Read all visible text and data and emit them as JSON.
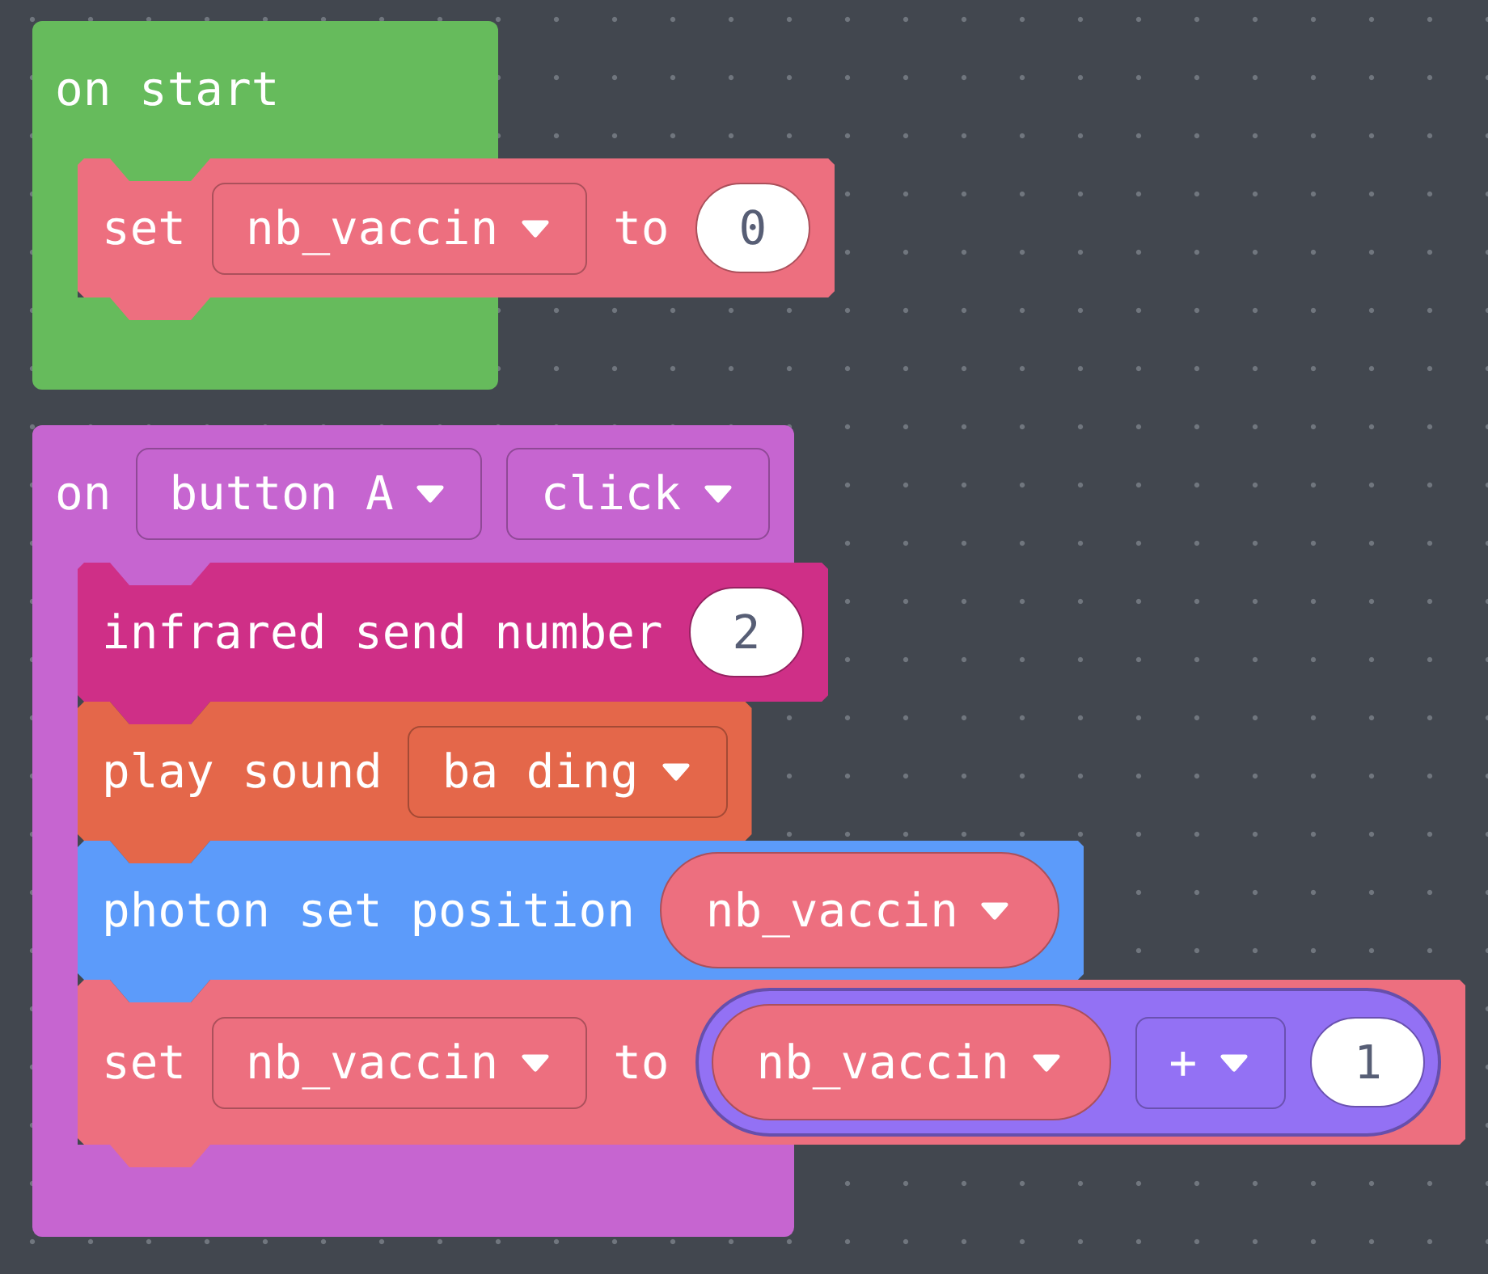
{
  "workspace": {
    "blocks": [
      {
        "color": "#66bb5c",
        "header": [
          {
            "kind": "label",
            "text": "on start"
          }
        ],
        "body": [
          {
            "color": "#ed6f7f",
            "parts": [
              {
                "kind": "label",
                "text": "set"
              },
              {
                "kind": "dropdown",
                "text": "nb_vaccin"
              },
              {
                "kind": "label",
                "text": "to"
              },
              {
                "kind": "number",
                "text": "0"
              }
            ]
          }
        ]
      },
      {
        "color": "#c665d0",
        "header": [
          {
            "kind": "label",
            "text": "on"
          },
          {
            "kind": "dropdown",
            "text": "button A"
          },
          {
            "kind": "dropdown",
            "text": "click"
          }
        ],
        "body": [
          {
            "color": "#cf2f87",
            "parts": [
              {
                "kind": "label",
                "text": "infrared send number"
              },
              {
                "kind": "number",
                "text": "2"
              }
            ]
          },
          {
            "color": "#e4674a",
            "parts": [
              {
                "kind": "label",
                "text": "play sound"
              },
              {
                "kind": "dropdown",
                "text": "ba ding"
              }
            ]
          },
          {
            "color": "#5c9bfa",
            "parts": [
              {
                "kind": "label",
                "text": "photon set position"
              },
              {
                "kind": "reporter",
                "color": "#ed6f7f",
                "text": "nb_vaccin"
              }
            ]
          },
          {
            "color": "#ed6f7f",
            "parts": [
              {
                "kind": "label",
                "text": "set"
              },
              {
                "kind": "dropdown",
                "text": "nb_vaccin"
              },
              {
                "kind": "label",
                "text": "to"
              },
              {
                "kind": "operation",
                "color": "#9371f4",
                "parts": [
                  {
                    "kind": "reporter",
                    "color": "#ed6f7f",
                    "text": "nb_vaccin"
                  },
                  {
                    "kind": "dropdown",
                    "text": "+"
                  },
                  {
                    "kind": "number",
                    "text": "1"
                  }
                ]
              }
            ]
          }
        ]
      }
    ]
  }
}
